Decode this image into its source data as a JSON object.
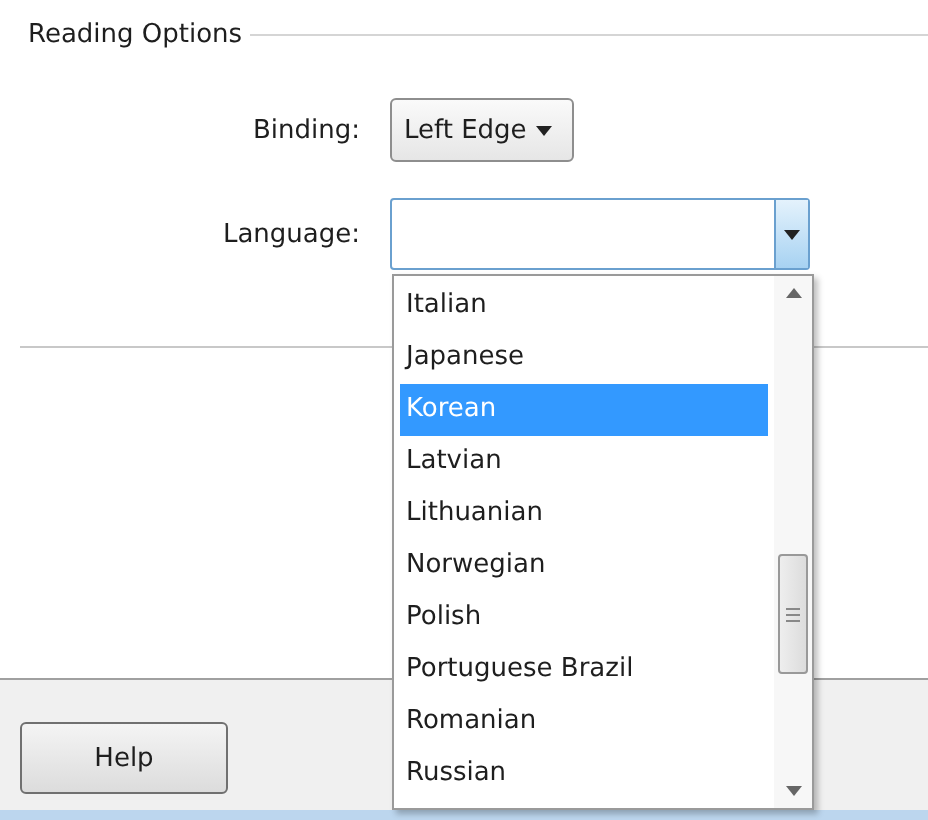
{
  "group": {
    "title": "Reading Options"
  },
  "binding": {
    "label": "Binding:",
    "value": "Left Edge"
  },
  "language": {
    "label": "Language:",
    "expanded": true,
    "options": [
      {
        "label": "Italian",
        "selected": false
      },
      {
        "label": "Japanese",
        "selected": false
      },
      {
        "label": "Korean",
        "selected": true
      },
      {
        "label": "Latvian",
        "selected": false
      },
      {
        "label": "Lithuanian",
        "selected": false
      },
      {
        "label": "Norwegian",
        "selected": false
      },
      {
        "label": "Polish",
        "selected": false
      },
      {
        "label": "Portuguese Brazil",
        "selected": false
      },
      {
        "label": "Romanian",
        "selected": false
      },
      {
        "label": "Russian",
        "selected": false
      }
    ]
  },
  "buttons": [
    {
      "label": "Help"
    }
  ]
}
